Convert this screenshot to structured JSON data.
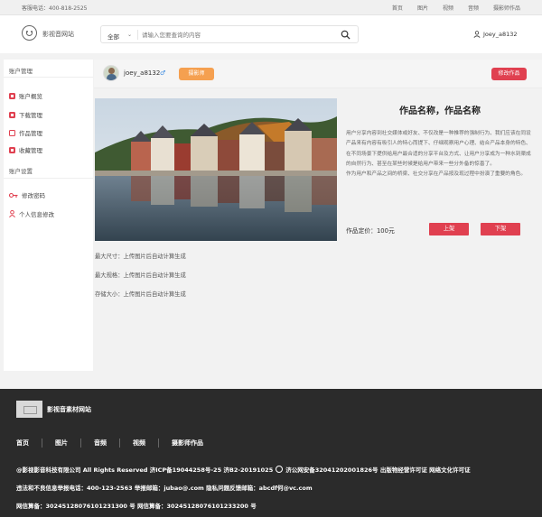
{
  "topbar": {
    "hotline": "客服电话：400-818-2525",
    "links": [
      "首页",
      "图片",
      "视频",
      "音频",
      "摄影师作品"
    ]
  },
  "header": {
    "site_name": "影视音网站",
    "search_scope": "全部",
    "search_placeholder": "请输入您要查询的内容",
    "username": "Joey_a8132"
  },
  "sidebar": {
    "group1": "账户管理",
    "items1": [
      {
        "label": "账户概览",
        "icon": "account-overview-icon"
      },
      {
        "label": "下载管理",
        "icon": "download-icon"
      },
      {
        "label": "作品管理",
        "icon": "works-icon"
      },
      {
        "label": "收藏管理",
        "icon": "favorites-icon"
      }
    ],
    "group2": "账户设置",
    "items2": [
      {
        "label": "修改密码",
        "icon": "key-icon"
      },
      {
        "label": "个人信息修改",
        "icon": "person-icon"
      }
    ]
  },
  "user_card": {
    "username": "joey_a8132",
    "gender": "♂",
    "badge": "摄影师",
    "edit_button": "修改作品"
  },
  "work": {
    "title": "作品名称，作品名称",
    "description": [
      "用户分享内容到社交媒体或好友、不仅改是一种推荐的强制行为、我们应该在同设产品来有内容有吸引人的特心而提下、仔细观察用户心理、结合产品本身的特色、在不同场景下提供给用户最合适的分享平台及方式、让用户分享成为一种水到渠成的自然行为、甚至在某些时候是给用户带来一些分外备的惊喜了。",
      "作为用户和产品之间的桥梁、社交分享在产品按及现过程中扮演了重要的角色。"
    ],
    "price": "作品定价：100元",
    "btn_up": "上架",
    "btn_down": "下架",
    "meta": [
      "最大尺寸：上传图片后自动计算生成",
      "最大规格：上传图片后自动计算生成",
      "存储大小：上传图片后自动计算生成"
    ]
  },
  "footer": {
    "site_name": "影视音素材网站",
    "nav": [
      "首页",
      "图片",
      "音频",
      "视频",
      "摄影师作品"
    ],
    "copyright": "@影视影音科技有限公司 All Rights Reserved 济ICP备19044258号-25 济B2-20191025",
    "copyright2": "济公网安备32041202001826号 出版物经营许可证 网络文化许可证",
    "report": "违法和不良信息举报电话：400-123-2563 举报邮箱：jubao@.com 隐私问题反馈邮箱：abcdf何@vc.com",
    "icp": "网信算备：302451280761012313​00 号 网信算备：302451280761012332​00 号"
  }
}
